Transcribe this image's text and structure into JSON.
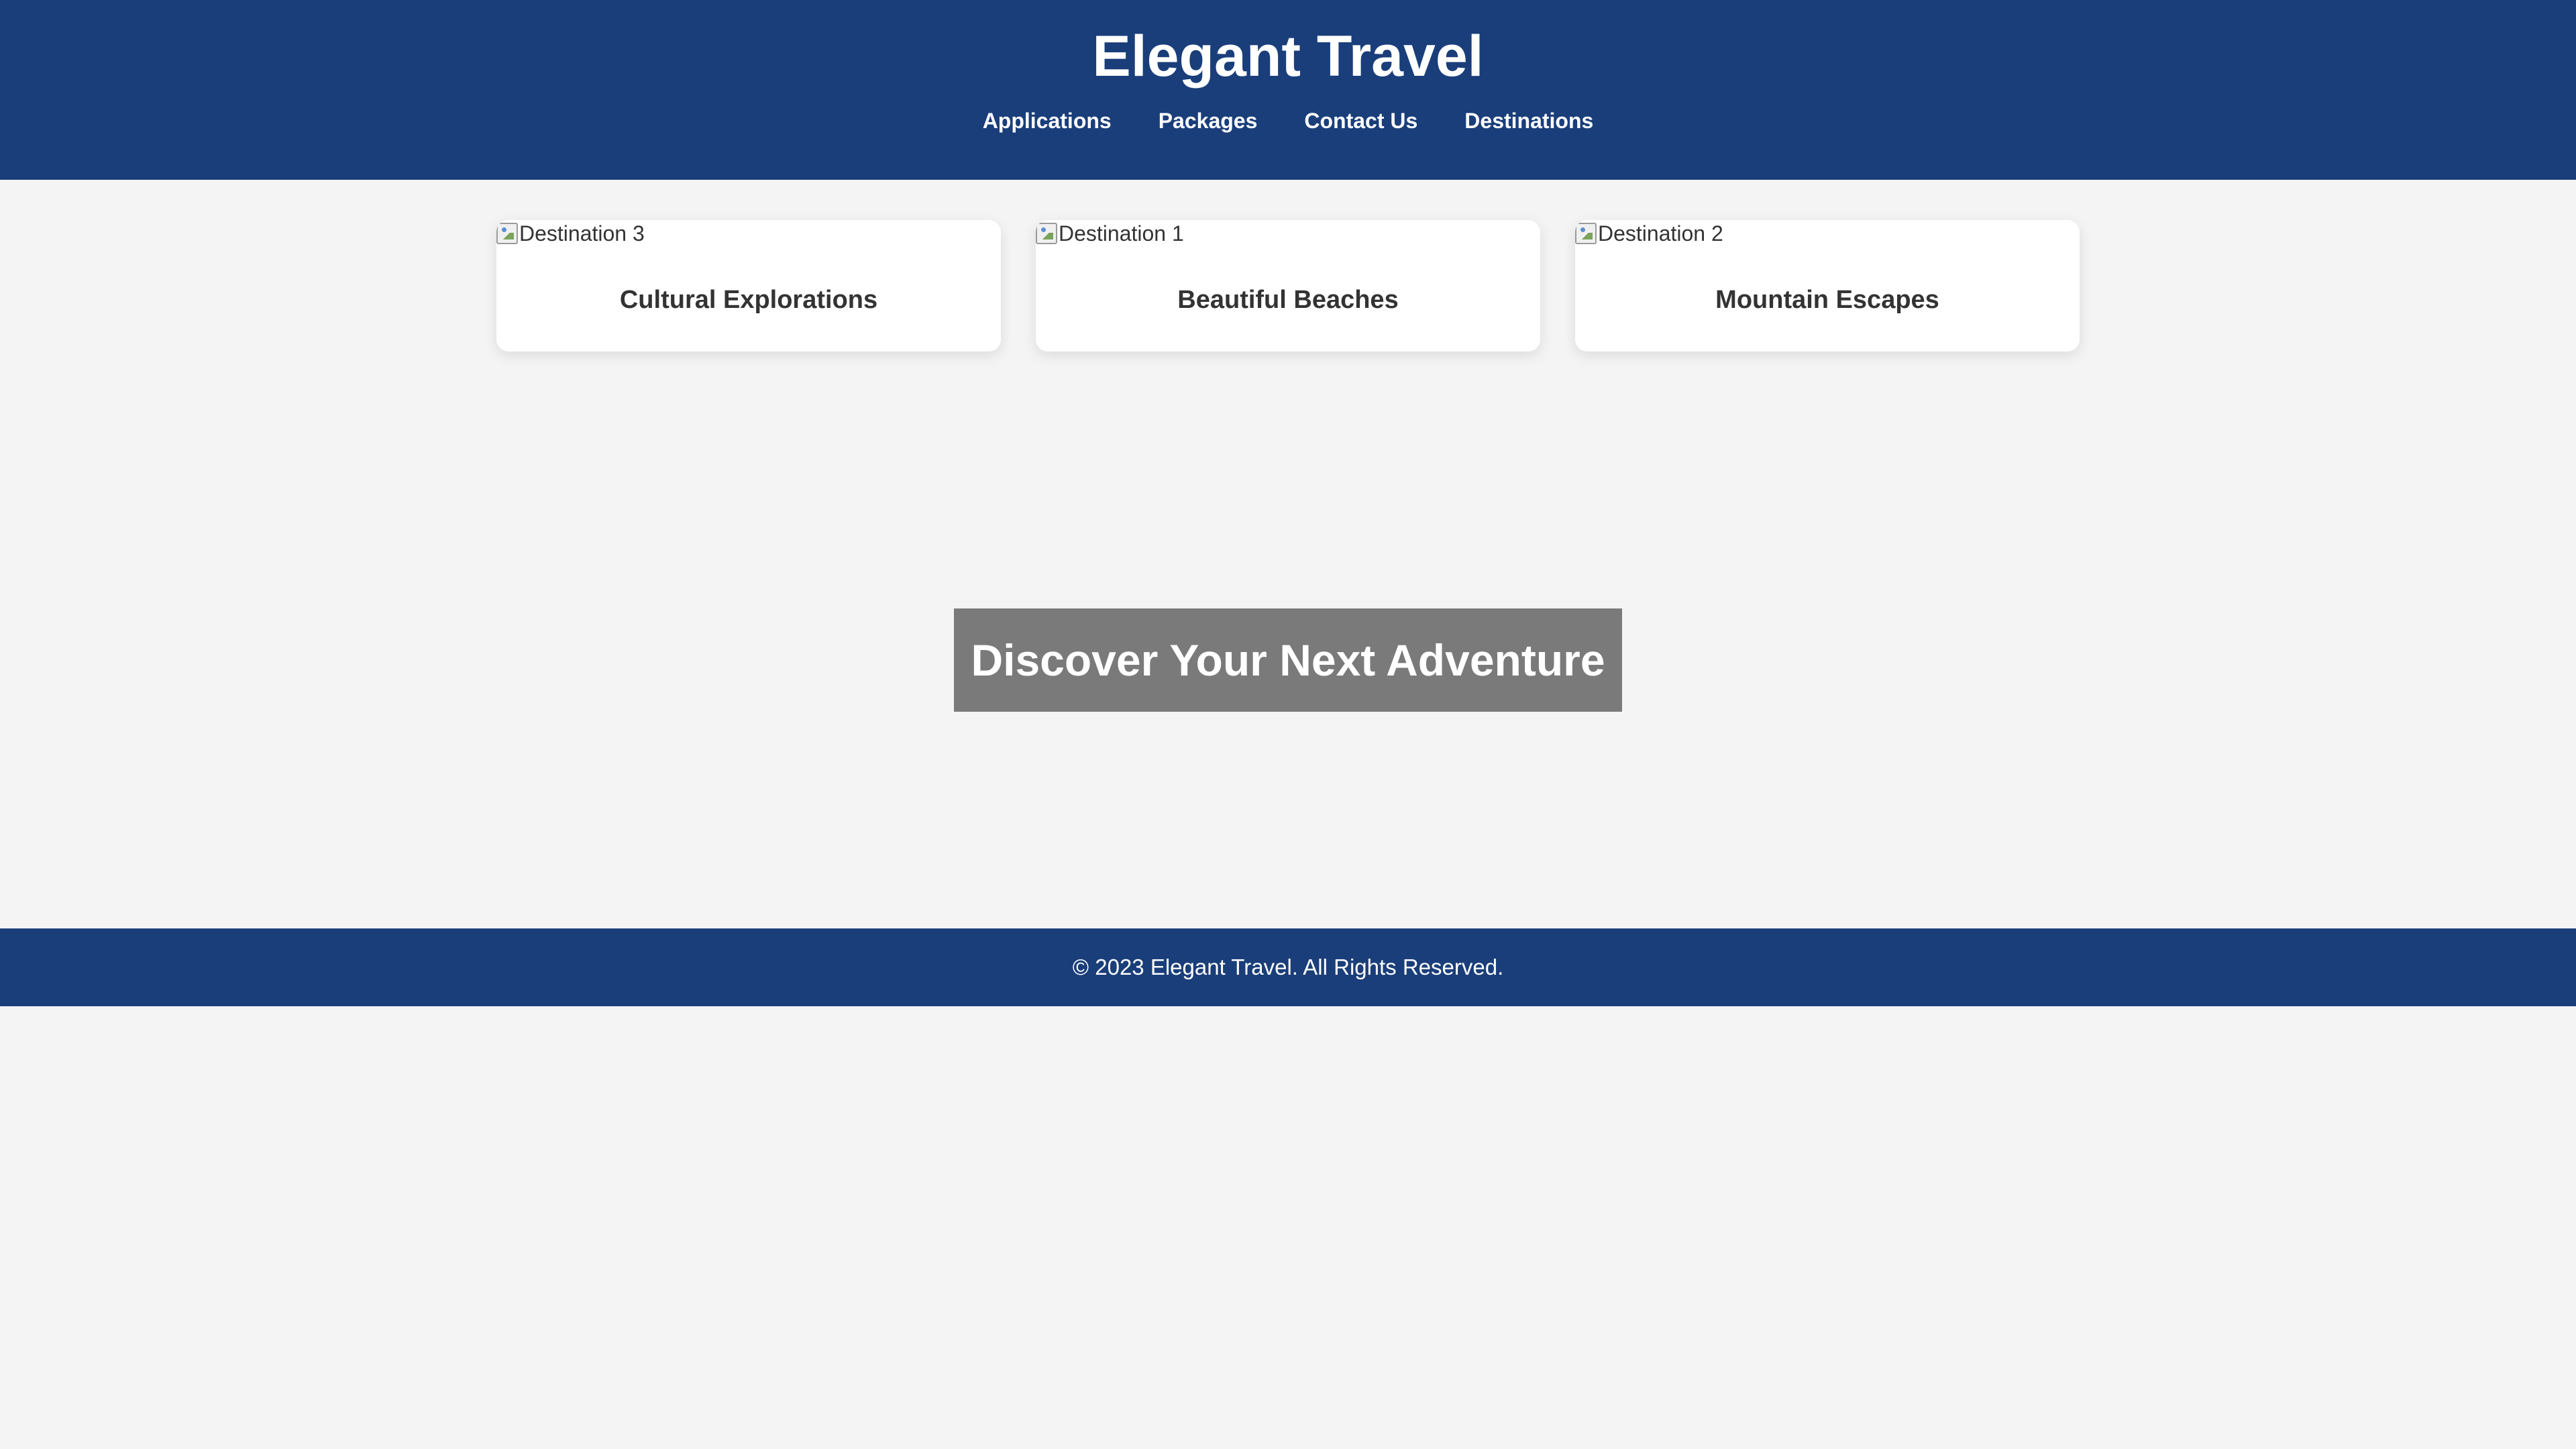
{
  "colors": {
    "header_bg": "#1a3e7a",
    "page_bg": "#f4f4f4",
    "card_bg": "#ffffff",
    "hero_overlay": "rgba(0,0,0,0.5)",
    "text": "#333333"
  },
  "header": {
    "title": "Elegant Travel",
    "nav": [
      {
        "label": "Applications"
      },
      {
        "label": "Packages"
      },
      {
        "label": "Contact Us"
      },
      {
        "label": "Destinations"
      }
    ]
  },
  "cards": [
    {
      "image_alt": "Destination 3",
      "title": "Cultural Explorations",
      "icon": "broken-image-icon"
    },
    {
      "image_alt": "Destination 1",
      "title": "Beautiful Beaches",
      "icon": "broken-image-icon"
    },
    {
      "image_alt": "Destination 2",
      "title": "Mountain Escapes",
      "icon": "broken-image-icon"
    }
  ],
  "hero": {
    "title": "Discover Your Next Adventure"
  },
  "footer": {
    "text": "© 2023 Elegant Travel. All Rights Reserved."
  }
}
